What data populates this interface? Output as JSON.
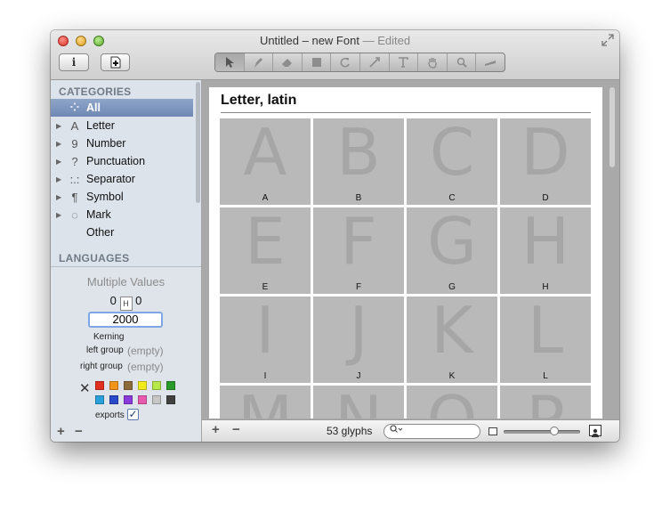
{
  "window": {
    "title": "Untitled – new Font",
    "title_suffix": "— Edited"
  },
  "toolbar": {
    "info_label": "i",
    "add_label": "+",
    "tools": [
      "select-tool",
      "draw-tool",
      "eraser-tool",
      "rectangle-tool",
      "rotate-tool",
      "scale-tool",
      "text-tool",
      "hand-tool",
      "zoom-tool",
      "measure-tool"
    ]
  },
  "sidebar": {
    "categories_header": "CATEGORIES",
    "categories": [
      {
        "label": "All",
        "icon": "⁘",
        "selected": true,
        "disclosure": ""
      },
      {
        "label": "Letter",
        "icon": "A",
        "selected": false,
        "disclosure": "▶"
      },
      {
        "label": "Number",
        "icon": "9",
        "selected": false,
        "disclosure": "▶"
      },
      {
        "label": "Punctuation",
        "icon": "?",
        "selected": false,
        "disclosure": "▶"
      },
      {
        "label": "Separator",
        "icon": ":.:",
        "selected": false,
        "disclosure": "▶"
      },
      {
        "label": "Symbol",
        "icon": "¶",
        "selected": false,
        "disclosure": "▶"
      },
      {
        "label": "Mark",
        "icon": "◌",
        "selected": false,
        "disclosure": "▶"
      },
      {
        "label": "Other",
        "icon": "",
        "selected": false,
        "disclosure": ""
      }
    ],
    "languages_header": "LANGUAGES"
  },
  "info_panel": {
    "multiple_values": "Multiple Values",
    "left_sidebearing": "0",
    "right_sidebearing": "0",
    "width_value": "2000",
    "kerning_label": "Kerning",
    "left_group_label": "left group",
    "left_group_value": "(empty)",
    "right_group_label": "right group",
    "right_group_value": "(empty)",
    "color_swatches": [
      "#e0301e",
      "#f2951b",
      "#8e6b3a",
      "#f2ea1b",
      "#b6e84a",
      "#2a9a2a",
      "#2aa0d8",
      "#2a49c8",
      "#8a3ad8",
      "#e85ab0",
      "#c6c6c6",
      "#404040"
    ],
    "exports_label": "exports",
    "exports_checked": true,
    "add_symbol": "+",
    "remove_symbol": "−"
  },
  "main": {
    "section_title": "Letter, latin",
    "glyphs": [
      {
        "char": "A",
        "name": "A"
      },
      {
        "char": "B",
        "name": "B"
      },
      {
        "char": "C",
        "name": "C"
      },
      {
        "char": "D",
        "name": "D"
      },
      {
        "char": "E",
        "name": "E"
      },
      {
        "char": "F",
        "name": "F"
      },
      {
        "char": "G",
        "name": "G"
      },
      {
        "char": "H",
        "name": "H"
      },
      {
        "char": "I",
        "name": "I"
      },
      {
        "char": "J",
        "name": "J"
      },
      {
        "char": "K",
        "name": "K"
      },
      {
        "char": "L",
        "name": "L"
      },
      {
        "char": "M",
        "name": ""
      },
      {
        "char": "N",
        "name": ""
      },
      {
        "char": "O",
        "name": ""
      },
      {
        "char": "P",
        "name": ""
      }
    ]
  },
  "statusbar": {
    "add_symbol": "+",
    "remove_symbol": "−",
    "glyph_count": "53 glyphs",
    "search_icon": "search-icon",
    "search_value": "",
    "zoom_fraction": 0.66
  }
}
